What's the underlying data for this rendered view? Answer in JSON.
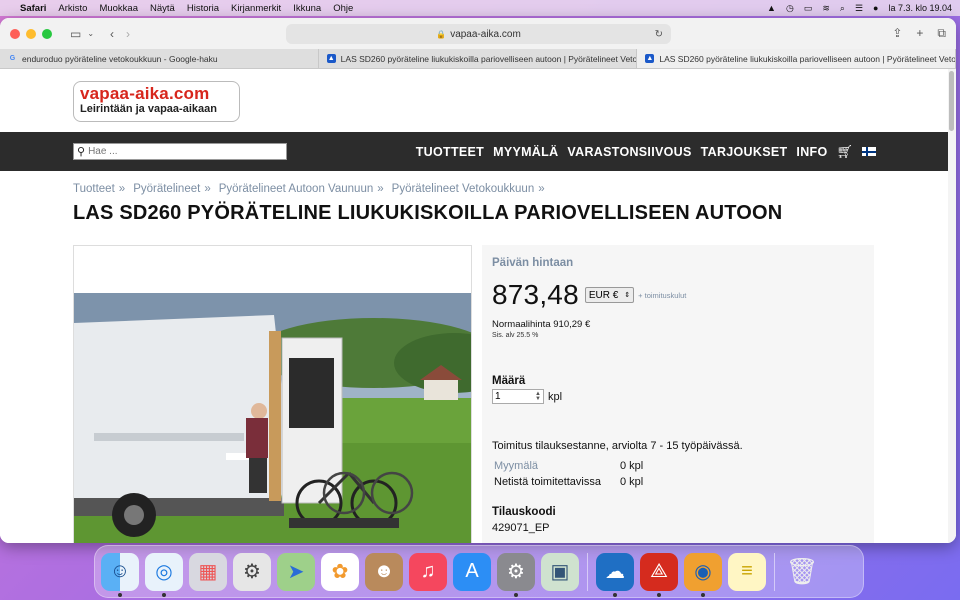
{
  "menubar": {
    "app": "Safari",
    "items": [
      "Arkisto",
      "Muokkaa",
      "Näytä",
      "Historia",
      "Kirjanmerkit",
      "Ikkuna",
      "Ohje"
    ],
    "clock": "la 7.3. klo 19.04"
  },
  "browser": {
    "url": "vapaa-aika.com",
    "tabs": [
      {
        "label": "enduroduo pyöräteline vetokoukkuun - Google-haku",
        "icon": "google-icon"
      },
      {
        "label": "LAS SD260 pyöräteline liukukiskoilla pariovelliseen autoon | Pyörätelineet Veto...",
        "icon": "site-icon"
      },
      {
        "label": "LAS SD260 pyöräteline liukukiskoilla pariovelliseen autoon | Pyörätelineet Veto...",
        "icon": "site-icon"
      }
    ]
  },
  "site": {
    "logo_line1": "vapaa-aika.com",
    "logo_line2": "Leirintään ja vapaa-aikaan",
    "search_placeholder": "Hae ...",
    "nav": [
      "TUOTTEET",
      "MYYMÄLÄ",
      "VARASTONSIIVOUS",
      "TARJOUKSET",
      "INFO"
    ],
    "breadcrumb": [
      "Tuotteet",
      "Pyörätelineet",
      "Pyörätelineet Autoon Vaunuun",
      "Pyörätelineet Vetokoukkuun"
    ],
    "breadcrumb_sep": "»",
    "title": "LAS SD260 PYÖRÄTELINE LIUKUKISKOILLA PARIOVELLISEEN AUTOON"
  },
  "product": {
    "price_label": "Päivän hintaan",
    "price": "873,48",
    "currency": "EUR €",
    "shipping": "+ toimituskulut",
    "normal_price": "Normaalihinta 910,29 €",
    "vat": "Sis. alv 25.5 %",
    "qty_label": "Määrä",
    "qty_value": "1",
    "qty_unit": "kpl",
    "delivery": "Toimitus tilauksestanne, arviolta 7 - 15 työpäivässä.",
    "stock": [
      {
        "label": "Myymälä",
        "value": "0 kpl"
      },
      {
        "label": "Netistä toimitettavissa",
        "value": "0 kpl"
      }
    ],
    "code_label": "Tilauskoodi",
    "code_value": "429071_EP"
  },
  "dock": [
    "finder-icon",
    "safari-icon",
    "launchpad-icon",
    "automator-icon",
    "maps-icon",
    "photos-icon",
    "contacts-icon",
    "music-icon",
    "app-store-icon",
    "system-preferences-icon",
    "archive-utility-icon",
    "openoffice-icon",
    "acrobat-icon",
    "network-globe-icon",
    "notes-icon",
    "trash-icon"
  ]
}
